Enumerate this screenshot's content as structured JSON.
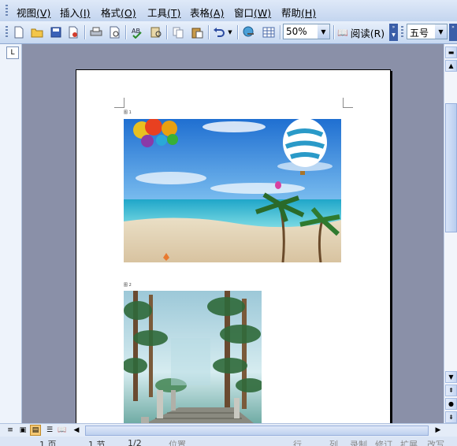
{
  "menubar": {
    "items": [
      {
        "label": "视图",
        "key": "(V)"
      },
      {
        "label": "插入",
        "key": "(I)"
      },
      {
        "label": "格式",
        "key": "(O)"
      },
      {
        "label": "工具",
        "key": "(T)"
      },
      {
        "label": "表格",
        "key": "(A)"
      },
      {
        "label": "窗口",
        "key": "(W)"
      },
      {
        "label": "帮助",
        "key": "(H)"
      }
    ]
  },
  "toolbar": {
    "zoom": "50%",
    "read_label": "阅读(R)",
    "font_size": "五号"
  },
  "document": {
    "caption1": "图 1",
    "caption2": "图 2"
  },
  "statusbar": {
    "page": "1 页",
    "section": "1 节",
    "page_of": "1/2",
    "position": "位置",
    "line": "行",
    "column": "列",
    "rec": "录制",
    "trk": "修订",
    "ext": "扩展",
    "ovr": "改写"
  },
  "colors": {
    "accent": "#c3d5ef",
    "workspace": "#8a90a8"
  }
}
